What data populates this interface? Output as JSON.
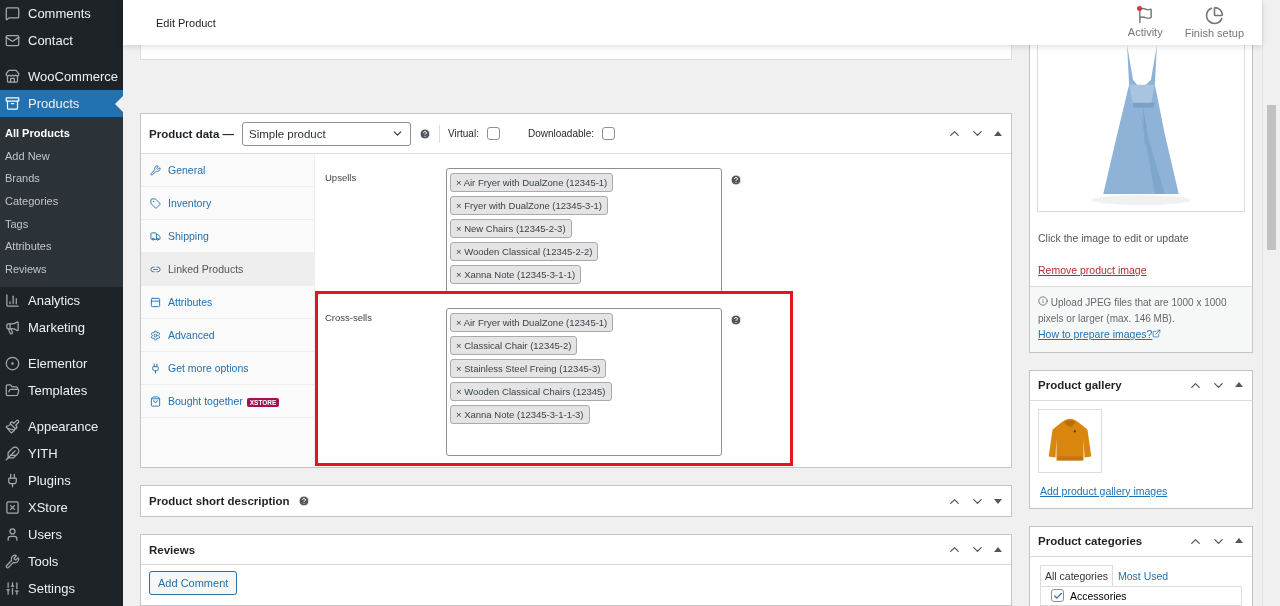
{
  "sidebar": {
    "groups": [
      [
        {
          "label": "Comments",
          "selected": false
        },
        {
          "label": "Contact",
          "selected": false
        }
      ],
      [
        {
          "label": "WooCommerce",
          "selected": false
        },
        {
          "label": "Products",
          "selected": true,
          "children": [
            {
              "label": "All Products",
              "selected": true
            },
            {
              "label": "Add New",
              "selected": false
            },
            {
              "label": "Brands",
              "selected": false
            },
            {
              "label": "Categories",
              "selected": false
            },
            {
              "label": "Tags",
              "selected": false
            },
            {
              "label": "Attributes",
              "selected": false
            },
            {
              "label": "Reviews",
              "selected": false
            }
          ]
        },
        {
          "label": "Analytics",
          "selected": false
        },
        {
          "label": "Marketing",
          "selected": false
        }
      ],
      [
        {
          "label": "Elementor",
          "selected": false
        },
        {
          "label": "Templates",
          "selected": false
        }
      ],
      [
        {
          "label": "Appearance",
          "selected": false
        },
        {
          "label": "YITH",
          "selected": false
        },
        {
          "label": "Plugins",
          "selected": false
        },
        {
          "label": "XStore",
          "selected": false
        },
        {
          "label": "Users",
          "selected": false
        },
        {
          "label": "Tools",
          "selected": false
        },
        {
          "label": "Settings",
          "selected": false
        }
      ]
    ]
  },
  "header": {
    "title": "Edit Product",
    "actions": [
      {
        "label": "Activity",
        "notification": true
      },
      {
        "label": "Finish setup",
        "notification": false
      }
    ]
  },
  "product_data": {
    "title": "Product data —",
    "product_type": "Simple product",
    "expanded": true,
    "virtual": {
      "label": "Virtual:",
      "checked": false
    },
    "downloadable": {
      "label": "Downloadable:",
      "checked": false
    },
    "tabs": [
      {
        "label": "General",
        "selected": false
      },
      {
        "label": "Inventory",
        "selected": false
      },
      {
        "label": "Shipping",
        "selected": false
      },
      {
        "label": "Linked Products",
        "selected": true
      },
      {
        "label": "Attributes",
        "selected": false
      },
      {
        "label": "Advanced",
        "selected": false
      },
      {
        "label": "Get more options",
        "selected": false
      },
      {
        "label": "Bought together",
        "selected": false,
        "badge": "XSTORE"
      }
    ],
    "fields": [
      {
        "label": "Upsells",
        "highlighted": false,
        "tags": [
          "× Air Fryer with DualZone (12345-1)",
          "× Fryer with DualZone (12345-3-1)",
          "× New Chairs (12345-2-3)",
          "× Wooden Classical (12345-2-2)",
          "× Xanna Note (12345-3-1-1)"
        ]
      },
      {
        "label": "Cross-sells",
        "highlighted": true,
        "tags": [
          "× Air Fryer with DualZone (12345-1)",
          "× Classical Chair (12345-2)",
          "× Stainless Steel Freing (12345-3)",
          "× Wooden Classical Chairs (12345)",
          "× Xanna Note (12345-3-1-1-3)"
        ]
      }
    ]
  },
  "short_description": {
    "title": "Product short description",
    "expanded": false
  },
  "reviews": {
    "title": "Reviews",
    "expanded": true,
    "button": "Add Comment"
  },
  "product_image": {
    "hint": "Click the image to edit or update",
    "remove_link": "Remove product image",
    "note": "Upload JPEG files that are 1000 x 1000 pixels or larger (max. 146 MB).",
    "note_link": "How to prepare images?"
  },
  "product_gallery": {
    "title": "Product gallery",
    "expanded": true,
    "link": "Add product gallery images"
  },
  "product_categories": {
    "title": "Product categories",
    "expanded": true,
    "tabs": [
      {
        "label": "All categories",
        "selected": true
      },
      {
        "label": "Most Used",
        "selected": false
      }
    ],
    "items": [
      {
        "label": "Accessories",
        "checked": true
      }
    ]
  }
}
